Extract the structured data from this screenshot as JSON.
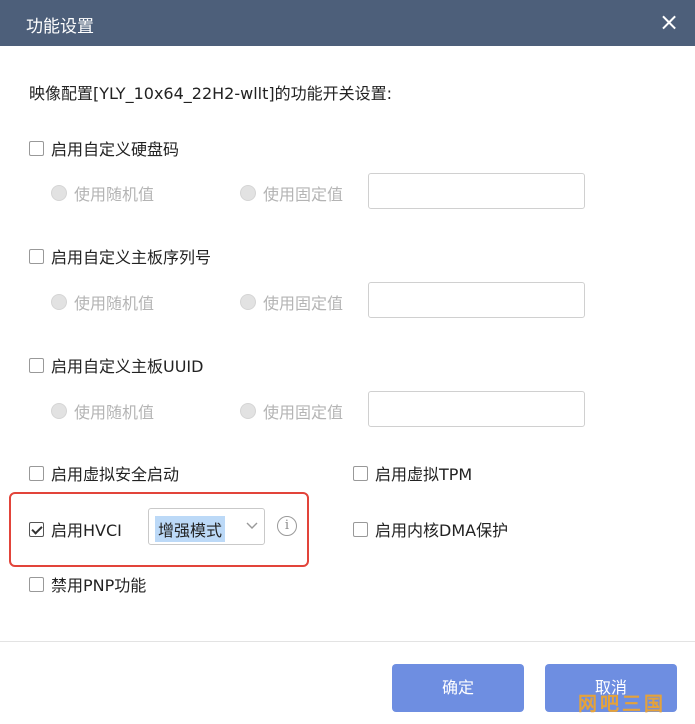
{
  "dialog": {
    "title": "功能设置",
    "close_icon": "×",
    "intro": "映像配置[YLY_10x64_22H2-wllt]的功能开关设置:"
  },
  "hdd_serial": {
    "label": "启用自定义硬盘码",
    "checked": false,
    "random_label": "使用随机值",
    "fixed_label": "使用固定值",
    "value": ""
  },
  "board_serial": {
    "label": "启用自定义主板序列号",
    "checked": false,
    "random_label": "使用随机值",
    "fixed_label": "使用固定值",
    "value": ""
  },
  "board_uuid": {
    "label": "启用自定义主板UUID",
    "checked": false,
    "random_label": "使用随机值",
    "fixed_label": "使用固定值",
    "value": ""
  },
  "options": {
    "secure_boot": {
      "label": "启用虚拟安全启动",
      "checked": false
    },
    "vtpm": {
      "label": "启用虚拟TPM",
      "checked": false
    },
    "hvci": {
      "label": "启用HVCI",
      "checked": true,
      "mode": "增强模式",
      "info_icon": "i"
    },
    "dma": {
      "label": "启用内核DMA保护",
      "checked": false
    },
    "pnp": {
      "label": "禁用PNP功能",
      "checked": false
    }
  },
  "footer": {
    "ok_label": "确定",
    "cancel_label": "取消"
  },
  "watermark": "网吧三国",
  "colors": {
    "titlebar": "#4d5f7a",
    "button": "#6e8ee1",
    "highlight_border": "#e2443a",
    "selection": "#bcd9f7"
  }
}
